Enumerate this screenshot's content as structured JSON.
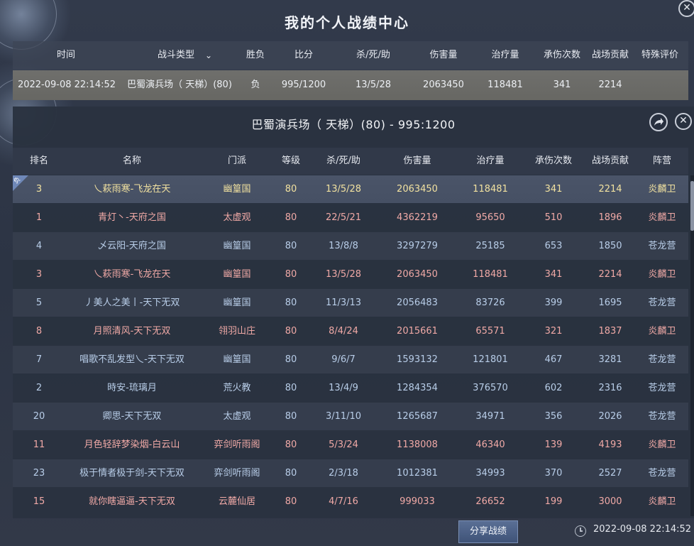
{
  "header": {
    "title": "我的个人战绩中心",
    "close_icon": "close-icon"
  },
  "summary": {
    "columns": [
      "时间",
      "战斗类型",
      "胜负",
      "比分",
      "杀/死/助",
      "伤害量",
      "治疗量",
      "承伤次数",
      "战场贡献",
      "特殊评价"
    ],
    "filter_icon": "chevron-down-icon",
    "row": {
      "time": "2022-09-08 22:14:52",
      "battle_type": "巴蜀演兵场（ 天梯）(80)",
      "result": "负",
      "score": "995/1200",
      "kda": "13/5/28",
      "damage": "2063450",
      "healing": "118481",
      "hits_taken": "341",
      "contribution": "2214",
      "special": ""
    }
  },
  "detail": {
    "title": "巴蜀演兵场（ 天梯）(80) - 995:1200",
    "share_icon": "share-icon",
    "columns": [
      "排名",
      "名称",
      "门派",
      "等级",
      "杀/死/助",
      "伤害量",
      "治疗量",
      "承伤次数",
      "战场贡献",
      "阵营"
    ],
    "self_badge": "负",
    "rows": [
      {
        "rank": "3",
        "name": "乀萩雨寒-飞龙在天",
        "sect": "幽篁国",
        "level": "80",
        "kda": "13/5/28",
        "damage": "2063450",
        "healing": "118481",
        "hits": "341",
        "contrib": "2214",
        "camp": "炎麟卫",
        "side": "self"
      },
      {
        "rank": "1",
        "name": "青灯丶-天府之国",
        "sect": "太虚观",
        "level": "80",
        "kda": "22/5/21",
        "damage": "4362219",
        "healing": "95650",
        "hits": "510",
        "contrib": "1896",
        "camp": "炎麟卫",
        "side": "red"
      },
      {
        "rank": "4",
        "name": "乄云阳-天府之国",
        "sect": "幽篁国",
        "level": "80",
        "kda": "13/8/8",
        "damage": "3297279",
        "healing": "25185",
        "hits": "653",
        "contrib": "1850",
        "camp": "苍龙营",
        "side": "blue"
      },
      {
        "rank": "3",
        "name": "乀萩雨寒-飞龙在天",
        "sect": "幽篁国",
        "level": "80",
        "kda": "13/5/28",
        "damage": "2063450",
        "healing": "118481",
        "hits": "341",
        "contrib": "2214",
        "camp": "炎麟卫",
        "side": "red"
      },
      {
        "rank": "5",
        "name": "丿美人之美丨-天下无双",
        "sect": "幽篁国",
        "level": "80",
        "kda": "11/3/13",
        "damage": "2056483",
        "healing": "83726",
        "hits": "399",
        "contrib": "1695",
        "camp": "苍龙营",
        "side": "blue"
      },
      {
        "rank": "8",
        "name": "月照清风-天下无双",
        "sect": "翎羽山庄",
        "level": "80",
        "kda": "8/4/24",
        "damage": "2015661",
        "healing": "65571",
        "hits": "321",
        "contrib": "1837",
        "camp": "炎麟卫",
        "side": "red"
      },
      {
        "rank": "7",
        "name": "唱歌不乱发型乀-天下无双",
        "sect": "幽篁国",
        "level": "80",
        "kda": "9/6/7",
        "damage": "1593132",
        "healing": "121801",
        "hits": "467",
        "contrib": "3281",
        "camp": "苍龙营",
        "side": "blue"
      },
      {
        "rank": "2",
        "name": "時安-琉璃月",
        "sect": "荒火教",
        "level": "80",
        "kda": "13/4/9",
        "damage": "1284354",
        "healing": "376570",
        "hits": "602",
        "contrib": "2316",
        "camp": "苍龙营",
        "side": "blue"
      },
      {
        "rank": "20",
        "name": "卿思-天下无双",
        "sect": "太虚观",
        "level": "80",
        "kda": "3/11/10",
        "damage": "1265687",
        "healing": "34971",
        "hits": "356",
        "contrib": "2026",
        "camp": "苍龙营",
        "side": "blue"
      },
      {
        "rank": "11",
        "name": "月色轻辞梦染烟-白云山",
        "sect": "弈剑听雨阁",
        "level": "80",
        "kda": "5/3/24",
        "damage": "1138008",
        "healing": "46340",
        "hits": "139",
        "contrib": "4193",
        "camp": "炎麟卫",
        "side": "red"
      },
      {
        "rank": "23",
        "name": "极于情者极于剑-天下无双",
        "sect": "弈剑听雨阁",
        "level": "80",
        "kda": "2/3/18",
        "damage": "1012381",
        "healing": "34993",
        "hits": "370",
        "contrib": "2527",
        "camp": "苍龙营",
        "side": "blue"
      },
      {
        "rank": "15",
        "name": "就你瞎逼逼-天下无双",
        "sect": "云麓仙居",
        "level": "80",
        "kda": "4/7/16",
        "damage": "999033",
        "healing": "26652",
        "hits": "199",
        "contrib": "3000",
        "camp": "炎麟卫",
        "side": "red"
      }
    ]
  },
  "footer": {
    "share_label": "分享战绩",
    "clock_icon": "clock-icon",
    "time": "2022-09-08 22:14:52"
  },
  "colors": {
    "red_team": "#f0a9a6",
    "blue_team": "#b8cde8",
    "self_row": "#f2e2a0"
  }
}
